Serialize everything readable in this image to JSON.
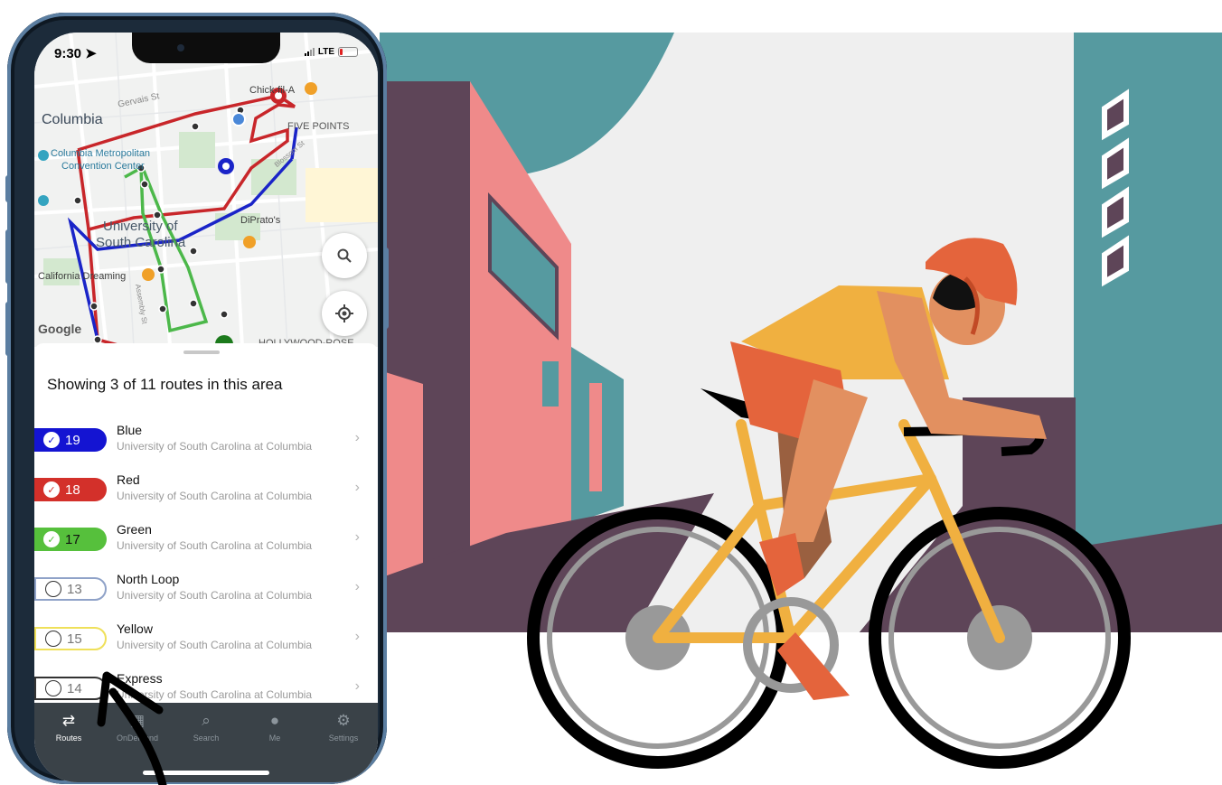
{
  "status_bar": {
    "time": "9:30",
    "network": "LTE"
  },
  "map": {
    "labels": {
      "city": "Columbia",
      "gervais": "Gervais St",
      "five_points": "FIVE POINTS",
      "convention_1": "Columbia Metropolitan",
      "convention_2": "Convention Center",
      "university_1": "University of",
      "university_2": "South Carolina",
      "diprato": "DiPrato's",
      "california": "California Dreaming",
      "hollywood": "HOLLYWOOD-ROSE",
      "chick": "Chick-fil-A",
      "blossom": "Blossom St",
      "assembly": "Assembly St",
      "google": "Google"
    },
    "route_colors": {
      "blue": "#1a24c8",
      "red": "#c8262a",
      "green": "#4cb84a"
    },
    "search_icon": "search-icon",
    "locate_icon": "crosshair-icon"
  },
  "sheet": {
    "title": "Showing 3 of 11 routes in this area",
    "routes": [
      {
        "number": "19",
        "name": "Blue",
        "agency": "University of South Carolina at Columbia",
        "selected": true,
        "color": "#1414d2"
      },
      {
        "number": "18",
        "name": "Red",
        "agency": "University of South Carolina at Columbia",
        "selected": true,
        "color": "#d3302a"
      },
      {
        "number": "17",
        "name": "Green",
        "agency": "University of South Carolina at Columbia",
        "selected": true,
        "color": "#56c03c"
      },
      {
        "number": "13",
        "name": "North Loop",
        "agency": "University of South Carolina at Columbia",
        "selected": false,
        "color": "#8fa2c8"
      },
      {
        "number": "15",
        "name": "Yellow",
        "agency": "University of South Carolina at Columbia",
        "selected": false,
        "color": "#efe05a"
      },
      {
        "number": "14",
        "name": "Express",
        "agency": "University of South Carolina at Columbia",
        "selected": false,
        "color": "#333333"
      }
    ]
  },
  "tabs": [
    {
      "label": "Routes",
      "icon": "routes-icon",
      "active": true
    },
    {
      "label": "OnDemand",
      "icon": "ondemand-icon",
      "active": false
    },
    {
      "label": "Search",
      "icon": "search-icon",
      "active": false
    },
    {
      "label": "Me",
      "icon": "person-icon",
      "active": false
    },
    {
      "label": "Settings",
      "icon": "gear-icon",
      "active": false
    }
  ],
  "colors": {
    "teal": "#569aa0",
    "plum": "#5e4558",
    "pink": "#ef8a8a",
    "sky": "#efefef",
    "jersey": "#f0b040",
    "shorts": "#e4643c",
    "skin": "#e29060",
    "bike": "#f0b040"
  }
}
